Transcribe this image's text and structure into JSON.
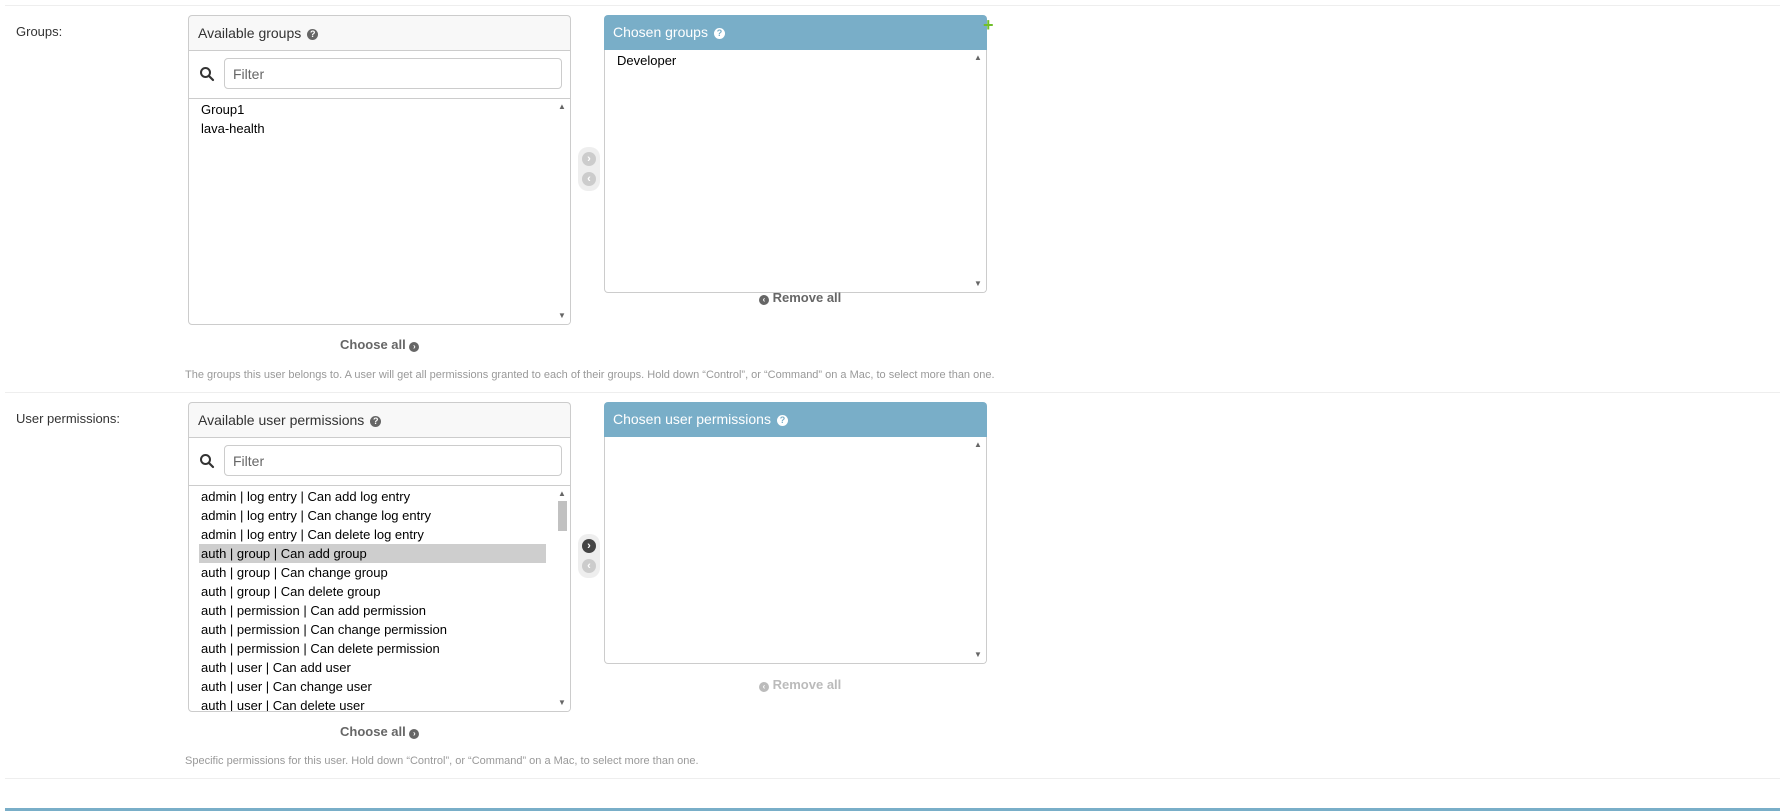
{
  "groups": {
    "label": "Groups:",
    "available": {
      "title": "Available groups",
      "filter_placeholder": "Filter",
      "items": [
        "Group1",
        "lava-health"
      ]
    },
    "chosen": {
      "title": "Chosen groups",
      "items": [
        "Developer"
      ]
    },
    "choose_all": "Choose all",
    "remove_all": "Remove all",
    "add_icon": "+",
    "help_text": "The groups this user belongs to. A user will get all permissions granted to each of their groups. Hold down “Control”, or “Command” on a Mac, to select more than one."
  },
  "permissions": {
    "label": "User permissions:",
    "available": {
      "title": "Available user permissions",
      "filter_placeholder": "Filter",
      "items": [
        "admin | log entry | Can add log entry",
        "admin | log entry | Can change log entry",
        "admin | log entry | Can delete log entry",
        "auth | group | Can add group",
        "auth | group | Can change group",
        "auth | group | Can delete group",
        "auth | permission | Can add permission",
        "auth | permission | Can change permission",
        "auth | permission | Can delete permission",
        "auth | user | Can add user",
        "auth | user | Can change user",
        "auth | user | Can delete user"
      ],
      "selected_item": "auth | group | Can add group"
    },
    "chosen": {
      "title": "Chosen user permissions",
      "items": []
    },
    "choose_all": "Choose all",
    "remove_all": "Remove all",
    "help_text": "Specific permissions for this user. Hold down “Control”, or “Command” on a Mac, to select more than one."
  },
  "colors": {
    "chosen_header": "#79aec8",
    "add_icon": "#70bf2b",
    "selected_row": "#cecece"
  }
}
